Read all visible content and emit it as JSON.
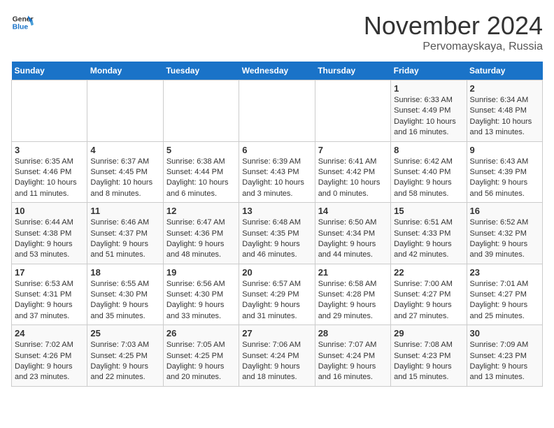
{
  "logo": {
    "line1": "General",
    "line2": "Blue"
  },
  "title": "November 2024",
  "subtitle": "Pervomayskaya, Russia",
  "days_header": [
    "Sunday",
    "Monday",
    "Tuesday",
    "Wednesday",
    "Thursday",
    "Friday",
    "Saturday"
  ],
  "weeks": [
    [
      {
        "day": "",
        "info": ""
      },
      {
        "day": "",
        "info": ""
      },
      {
        "day": "",
        "info": ""
      },
      {
        "day": "",
        "info": ""
      },
      {
        "day": "",
        "info": ""
      },
      {
        "day": "1",
        "info": "Sunrise: 6:33 AM\nSunset: 4:49 PM\nDaylight: 10 hours and 16 minutes."
      },
      {
        "day": "2",
        "info": "Sunrise: 6:34 AM\nSunset: 4:48 PM\nDaylight: 10 hours and 13 minutes."
      }
    ],
    [
      {
        "day": "3",
        "info": "Sunrise: 6:35 AM\nSunset: 4:46 PM\nDaylight: 10 hours and 11 minutes."
      },
      {
        "day": "4",
        "info": "Sunrise: 6:37 AM\nSunset: 4:45 PM\nDaylight: 10 hours and 8 minutes."
      },
      {
        "day": "5",
        "info": "Sunrise: 6:38 AM\nSunset: 4:44 PM\nDaylight: 10 hours and 6 minutes."
      },
      {
        "day": "6",
        "info": "Sunrise: 6:39 AM\nSunset: 4:43 PM\nDaylight: 10 hours and 3 minutes."
      },
      {
        "day": "7",
        "info": "Sunrise: 6:41 AM\nSunset: 4:42 PM\nDaylight: 10 hours and 0 minutes."
      },
      {
        "day": "8",
        "info": "Sunrise: 6:42 AM\nSunset: 4:40 PM\nDaylight: 9 hours and 58 minutes."
      },
      {
        "day": "9",
        "info": "Sunrise: 6:43 AM\nSunset: 4:39 PM\nDaylight: 9 hours and 56 minutes."
      }
    ],
    [
      {
        "day": "10",
        "info": "Sunrise: 6:44 AM\nSunset: 4:38 PM\nDaylight: 9 hours and 53 minutes."
      },
      {
        "day": "11",
        "info": "Sunrise: 6:46 AM\nSunset: 4:37 PM\nDaylight: 9 hours and 51 minutes."
      },
      {
        "day": "12",
        "info": "Sunrise: 6:47 AM\nSunset: 4:36 PM\nDaylight: 9 hours and 48 minutes."
      },
      {
        "day": "13",
        "info": "Sunrise: 6:48 AM\nSunset: 4:35 PM\nDaylight: 9 hours and 46 minutes."
      },
      {
        "day": "14",
        "info": "Sunrise: 6:50 AM\nSunset: 4:34 PM\nDaylight: 9 hours and 44 minutes."
      },
      {
        "day": "15",
        "info": "Sunrise: 6:51 AM\nSunset: 4:33 PM\nDaylight: 9 hours and 42 minutes."
      },
      {
        "day": "16",
        "info": "Sunrise: 6:52 AM\nSunset: 4:32 PM\nDaylight: 9 hours and 39 minutes."
      }
    ],
    [
      {
        "day": "17",
        "info": "Sunrise: 6:53 AM\nSunset: 4:31 PM\nDaylight: 9 hours and 37 minutes."
      },
      {
        "day": "18",
        "info": "Sunrise: 6:55 AM\nSunset: 4:30 PM\nDaylight: 9 hours and 35 minutes."
      },
      {
        "day": "19",
        "info": "Sunrise: 6:56 AM\nSunset: 4:30 PM\nDaylight: 9 hours and 33 minutes."
      },
      {
        "day": "20",
        "info": "Sunrise: 6:57 AM\nSunset: 4:29 PM\nDaylight: 9 hours and 31 minutes."
      },
      {
        "day": "21",
        "info": "Sunrise: 6:58 AM\nSunset: 4:28 PM\nDaylight: 9 hours and 29 minutes."
      },
      {
        "day": "22",
        "info": "Sunrise: 7:00 AM\nSunset: 4:27 PM\nDaylight: 9 hours and 27 minutes."
      },
      {
        "day": "23",
        "info": "Sunrise: 7:01 AM\nSunset: 4:27 PM\nDaylight: 9 hours and 25 minutes."
      }
    ],
    [
      {
        "day": "24",
        "info": "Sunrise: 7:02 AM\nSunset: 4:26 PM\nDaylight: 9 hours and 23 minutes."
      },
      {
        "day": "25",
        "info": "Sunrise: 7:03 AM\nSunset: 4:25 PM\nDaylight: 9 hours and 22 minutes."
      },
      {
        "day": "26",
        "info": "Sunrise: 7:05 AM\nSunset: 4:25 PM\nDaylight: 9 hours and 20 minutes."
      },
      {
        "day": "27",
        "info": "Sunrise: 7:06 AM\nSunset: 4:24 PM\nDaylight: 9 hours and 18 minutes."
      },
      {
        "day": "28",
        "info": "Sunrise: 7:07 AM\nSunset: 4:24 PM\nDaylight: 9 hours and 16 minutes."
      },
      {
        "day": "29",
        "info": "Sunrise: 7:08 AM\nSunset: 4:23 PM\nDaylight: 9 hours and 15 minutes."
      },
      {
        "day": "30",
        "info": "Sunrise: 7:09 AM\nSunset: 4:23 PM\nDaylight: 9 hours and 13 minutes."
      }
    ]
  ]
}
